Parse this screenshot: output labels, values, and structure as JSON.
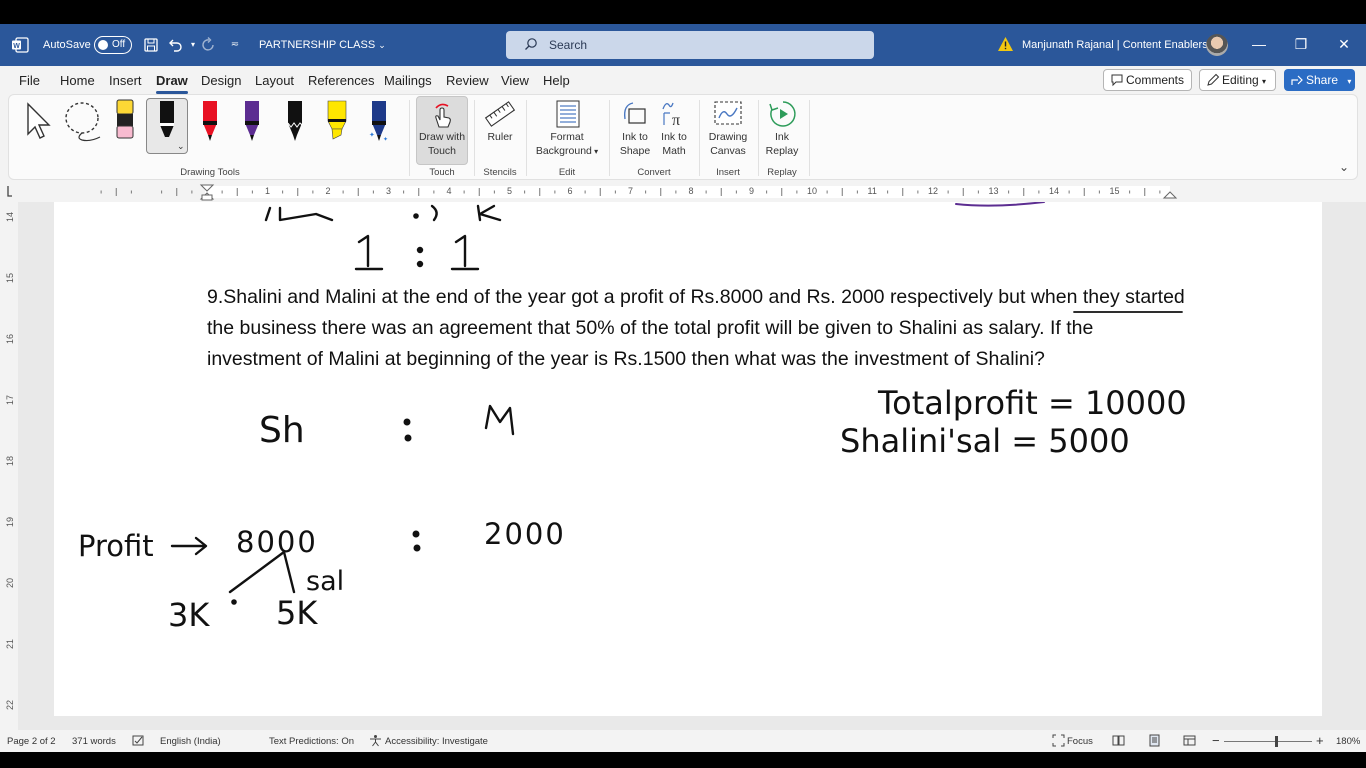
{
  "titlebar": {
    "autosave_label": "AutoSave",
    "autosave_state": "Off",
    "doc_title": "PARTNERSHIP CLASS",
    "search_placeholder": "Search",
    "user_name": "Manjunath Rajanal | Content Enablers",
    "accent": "#2b579a"
  },
  "tabs": [
    "File",
    "Home",
    "Insert",
    "Draw",
    "Design",
    "Layout",
    "References",
    "Mailings",
    "Review",
    "View",
    "Help"
  ],
  "active_tab": "Draw",
  "actions": {
    "comments": "Comments",
    "editing": "Editing",
    "share": "Share"
  },
  "ribbon": {
    "draw_with_touch_1": "Draw with",
    "draw_with_touch_2": "Touch",
    "ruler": "Ruler",
    "format_bg_1": "Format",
    "format_bg_2": "Background",
    "ink_shape_1": "Ink to",
    "ink_shape_2": "Shape",
    "ink_math_1": "Ink to",
    "ink_math_2": "Math",
    "drawing_canvas_1": "Drawing",
    "drawing_canvas_2": "Canvas",
    "ink_replay_1": "Ink",
    "ink_replay_2": "Replay",
    "groups": {
      "drawing_tools": "Drawing Tools",
      "touch": "Touch",
      "stencils": "Stencils",
      "edit": "Edit",
      "convert": "Convert",
      "insert": "Insert",
      "replay": "Replay"
    },
    "pen_colors": [
      "#000000",
      "#e81123",
      "#5c2d91",
      "#000000",
      "#ffe600",
      "#1e3a8a"
    ]
  },
  "ruler": {
    "numbers": [
      "1",
      "2",
      "3",
      "4",
      "5",
      "6",
      "7",
      "8",
      "9",
      "10",
      "11",
      "12",
      "13",
      "14",
      "15"
    ],
    "vertical_numbers": [
      "14",
      "15",
      "16",
      "17",
      "18",
      "19",
      "20",
      "21",
      "22"
    ]
  },
  "document": {
    "question": "9.Shalini and Malini at the end of the year got a profit of Rs.8000 and Rs. 2000 respectively but when they started the business there was an agreement that 50% of the total profit will be given to Shalini as salary. If the investment of Malini at beginning of the year is Rs.1500 then what was the investment of Shalini?",
    "ink": {
      "ratio_top": "1  :  1",
      "sh": "Sh",
      "colon": ":",
      "m": "M",
      "total_profit": "Totalprofit = 10000",
      "shalini_sal": "Shalini'sal = 5000",
      "profit_label": "Profit",
      "profit_s": "8000",
      "profit_m": "2000",
      "sal": "sal",
      "left_part": "3K",
      "right_part": "5K"
    }
  },
  "status": {
    "page": "Page 2 of 2",
    "words": "371 words",
    "language": "English (India)",
    "predictions": "Text Predictions: On",
    "accessibility": "Accessibility: Investigate",
    "focus": "Focus",
    "zoom": "180%"
  }
}
